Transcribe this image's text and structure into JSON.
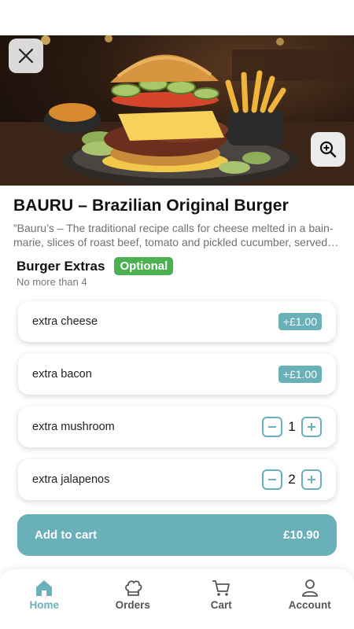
{
  "product": {
    "title": "BAURU – Brazilian Original Burger",
    "description": "”Bauru’s – The traditional recipe calls for cheese melted in a bain-marie, slices of roast beef, tomato and pickled cucumber, served in a French bread roll."
  },
  "extras": {
    "title": "Burger Extras",
    "badge": "Optional",
    "subtitle": "No more than 4",
    "items": [
      {
        "name": "extra cheese",
        "price": "+£1.00"
      },
      {
        "name": "extra bacon",
        "price": "+£1.00"
      },
      {
        "name": "extra mushroom",
        "qty": "1"
      },
      {
        "name": "extra jalapenos",
        "qty": "2"
      }
    ]
  },
  "cart": {
    "label": "Add to cart",
    "total": "£10.90"
  },
  "tabs": [
    {
      "label": "Home",
      "icon": "home-icon",
      "active": true
    },
    {
      "label": "Orders",
      "icon": "chef-hat-icon"
    },
    {
      "label": "Cart",
      "icon": "cart-icon"
    },
    {
      "label": "Account",
      "icon": "user-icon"
    }
  ],
  "colors": {
    "accent": "#6ab0b8",
    "badge": "#4caf50"
  }
}
